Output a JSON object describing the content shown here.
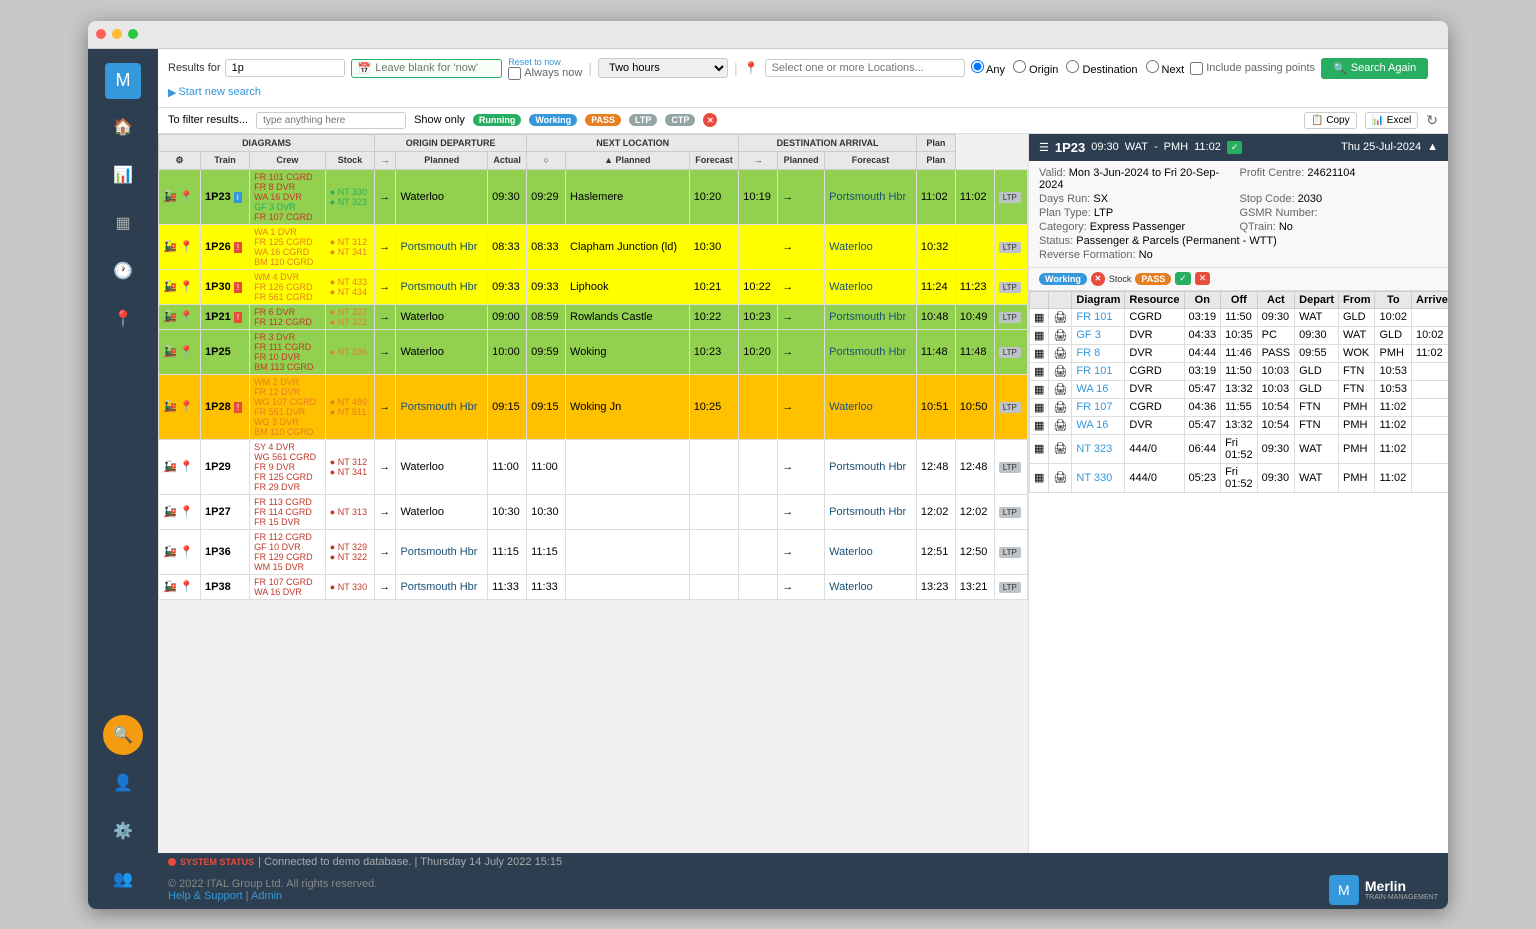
{
  "window": {
    "title": "Merlin Train Management"
  },
  "topbar": {
    "results_label": "Results for",
    "search_value": "1p",
    "datetime_placeholder": "Leave blank for 'now'",
    "always_now_label": "Always now",
    "reset_to_now": "Reset to now",
    "duration_value": "Two hours",
    "location_placeholder": "Select one or more Locations...",
    "radio_options": [
      "Any",
      "Origin",
      "Destination",
      "Next"
    ],
    "include_passing": "Include passing points",
    "search_again": "Search Again",
    "start_new_search": "Start new search"
  },
  "filterbar": {
    "filter_label": "To filter results...",
    "filter_placeholder": "type anything here",
    "show_only": "Show only",
    "badges": [
      "Running",
      "Working",
      "PASS",
      "LTP",
      "CTP"
    ],
    "buttons": [
      "Copy",
      "Excel"
    ]
  },
  "table": {
    "sections": {
      "diagrams": "DIAGRAMS",
      "origin_departure": "ORIGIN DEPARTURE",
      "next_location": "NEXT LOCATION",
      "destination_arrival": "DESTINATION ARRIVAL"
    },
    "columns": {
      "train": "Train",
      "crew": "Crew",
      "stock": "Stock",
      "origin_planned": "Planned",
      "origin_actual": "Actual",
      "next_planned": "Planned",
      "next_forecast": "Forecast",
      "dest_planned": "Planned",
      "dest_forecast": "Forecast",
      "plan": "Plan"
    },
    "rows": [
      {
        "id": "1P23",
        "color": "green",
        "origin": "Waterloo",
        "origin_planned": "09:30",
        "origin_actual": "09:29",
        "next_stop": "Haslemere",
        "next_planned": "10:20",
        "next_forecast": "10:19",
        "destination": "Portsmouth Hbr",
        "dest_planned": "11:02",
        "dest_forecast": "11:02",
        "plan": "LTP",
        "crew": [
          "FR 101 CGRD",
          "FR 8 DVR",
          "WA 16 DVR",
          "GF 3 DVR",
          "FR 107 CGRD"
        ],
        "crew_colors": [
          "red",
          "red",
          "red",
          "green",
          "red"
        ],
        "stock": [
          "NT 330",
          "NT 323"
        ],
        "stock_colors": [
          "green",
          "green"
        ]
      },
      {
        "id": "1P26",
        "color": "yellow",
        "origin": "Portsmouth Hbr",
        "origin_planned": "08:33",
        "origin_actual": "08:33",
        "next_stop": "Clapham Junction (ld)",
        "next_planned": "10:30",
        "next_forecast": "",
        "destination": "Waterloo",
        "dest_planned": "10:32",
        "dest_forecast": "",
        "plan": "LTP",
        "crew": [
          "WA 1 DVR",
          "FR 125 CGRD",
          "WA 16 CGRD",
          "BM 110 CGRD"
        ],
        "crew_colors": [
          "orange",
          "orange",
          "orange",
          "orange"
        ],
        "stock": [
          "NT 312",
          "NT 341"
        ],
        "stock_colors": [
          "orange",
          "orange"
        ]
      },
      {
        "id": "1P30",
        "color": "yellow",
        "origin": "Portsmouth Hbr",
        "origin_planned": "09:33",
        "origin_actual": "09:33",
        "next_stop": "Liphook",
        "next_planned": "10:21",
        "next_forecast": "10:22",
        "destination": "Waterloo",
        "dest_planned": "11:24",
        "dest_forecast": "11:23",
        "plan": "LTP",
        "crew": [
          "WM 4 DVR",
          "FR 126 CGRD",
          "FR 561 CGRD"
        ],
        "crew_colors": [
          "orange",
          "orange",
          "orange"
        ],
        "stock": [
          "NT 433",
          "NT 434"
        ],
        "stock_colors": [
          "orange",
          "orange"
        ]
      },
      {
        "id": "1P21",
        "color": "green",
        "origin": "Waterloo",
        "origin_planned": "09:00",
        "origin_actual": "08:59",
        "next_stop": "Rowlands Castle",
        "next_planned": "10:22",
        "next_forecast": "10:23",
        "destination": "Portsmouth Hbr",
        "dest_planned": "10:48",
        "dest_forecast": "10:49",
        "plan": "LTP",
        "crew": [
          "FR 6 DVR",
          "FR 112 CGRD"
        ],
        "crew_colors": [
          "red",
          "red"
        ],
        "stock": [
          "NT 327",
          "NT 322"
        ],
        "stock_colors": [
          "orange",
          "orange"
        ]
      },
      {
        "id": "1P25",
        "color": "green",
        "origin": "Waterloo",
        "origin_planned": "10:00",
        "origin_actual": "09:59",
        "next_stop": "Woking",
        "next_planned": "10:23",
        "next_forecast": "10:20",
        "destination": "Portsmouth Hbr",
        "dest_planned": "11:48",
        "dest_forecast": "11:48",
        "plan": "LTP",
        "crew": [
          "FR 3 DVR",
          "FR 111 CGRD",
          "FR 10 DVR",
          "BM 113 CGRD"
        ],
        "crew_colors": [
          "red",
          "red",
          "red",
          "red"
        ],
        "stock": [
          "NT 336"
        ],
        "stock_colors": [
          "orange"
        ]
      },
      {
        "id": "1P28",
        "color": "orange",
        "origin": "Portsmouth Hbr",
        "origin_planned": "09:15",
        "origin_actual": "09:15",
        "next_stop": "Woking Jn",
        "next_planned": "10:25",
        "next_forecast": "",
        "destination": "Waterloo",
        "dest_planned": "10:51",
        "dest_forecast": "10:50",
        "plan": "LTP",
        "crew": [
          "WM 2 DVR",
          "FR 12 DVR",
          "WG 107 CGRD",
          "FR 551 DVR",
          "WG 3 DVR",
          "BM 110 CGRD"
        ],
        "crew_colors": [
          "orange",
          "orange",
          "orange",
          "orange",
          "orange",
          "orange"
        ],
        "stock": [
          "NT 489",
          "NT 511"
        ],
        "stock_colors": [
          "orange",
          "orange"
        ]
      },
      {
        "id": "1P29",
        "color": "white",
        "origin": "Waterloo",
        "origin_planned": "11:00",
        "origin_actual": "11:00",
        "next_stop": "",
        "next_planned": "",
        "next_forecast": "",
        "destination": "Portsmouth Hbr",
        "dest_planned": "12:48",
        "dest_forecast": "12:48",
        "plan": "LTP",
        "crew": [
          "SY 4 DVR",
          "WG 561 CGRD",
          "FR 9 DVR",
          "FR 125 CGRD",
          "FR 29 DVR"
        ],
        "crew_colors": [
          "red",
          "red",
          "red",
          "red",
          "red"
        ],
        "stock": [
          "NT 312",
          "NT 341"
        ],
        "stock_colors": [
          "red",
          "red"
        ]
      },
      {
        "id": "1P27",
        "color": "white",
        "origin": "Waterloo",
        "origin_planned": "10:30",
        "origin_actual": "10:30",
        "next_stop": "",
        "next_planned": "",
        "next_forecast": "",
        "destination": "Portsmouth Hbr",
        "dest_planned": "12:02",
        "dest_forecast": "12:02",
        "plan": "LTP",
        "crew": [
          "FR 113 CGRD",
          "FR 114 CGRD",
          "FR 15 DVR"
        ],
        "crew_colors": [
          "red",
          "red",
          "red"
        ],
        "stock": [
          "NT 313"
        ],
        "stock_colors": [
          "red"
        ]
      },
      {
        "id": "1P36",
        "color": "white",
        "origin": "Portsmouth Hbr",
        "origin_planned": "11:15",
        "origin_actual": "11:15",
        "next_stop": "",
        "next_planned": "",
        "next_forecast": "",
        "destination": "Waterloo",
        "dest_planned": "12:51",
        "dest_forecast": "12:50",
        "plan": "LTP",
        "crew": [
          "FR 112 CGRD",
          "GF 10 DVR",
          "FR 129 CGRD",
          "WM 15 DVR"
        ],
        "crew_colors": [
          "red",
          "red",
          "red",
          "red"
        ],
        "stock": [
          "NT 329",
          "NT 322"
        ],
        "stock_colors": [
          "red",
          "red"
        ]
      },
      {
        "id": "1P38",
        "color": "white",
        "origin": "Portsmouth Hbr",
        "origin_planned": "11:33",
        "origin_actual": "11:33",
        "next_stop": "",
        "next_planned": "",
        "next_forecast": "",
        "destination": "Waterloo",
        "dest_planned": "13:23",
        "dest_forecast": "13:21",
        "plan": "LTP",
        "crew": [
          "FR 107 CGRD",
          "WA 16 DVR"
        ],
        "crew_colors": [
          "red",
          "red"
        ],
        "stock": [
          "NT 330"
        ],
        "stock_colors": [
          "red"
        ]
      }
    ]
  },
  "detail_panel": {
    "train_id": "1P23",
    "time_from": "09:30",
    "from_code": "WAT",
    "time_to": "11:02",
    "to_code": "PMH",
    "date": "Thu 25-Jul-2024",
    "valid": "Mon 3-Jun-2024 to Fri 20-Sep-2024",
    "days_run": "SX",
    "plan_type": "LTP",
    "category": "Express Passenger",
    "status": "Passenger & Parcels (Permanent - WTT)",
    "profit_centre": "24621104",
    "stop_code": "2030",
    "gsmr_number": "",
    "qtrain": "No",
    "reverse_formation": "No",
    "badges": [
      "Working",
      "Stock",
      "PASS"
    ],
    "detail_columns": [
      "",
      "",
      "Diagram",
      "Resource",
      "On",
      "Off",
      "Act",
      "Depart",
      "From",
      "To",
      "Arrive"
    ],
    "detail_rows": [
      {
        "diagram": "FR 101",
        "resource": "CGRD",
        "on": "03:19",
        "off": "11:50",
        "act": "09:30",
        "depart": "WAT",
        "from": "GLD",
        "to": "10:02",
        "arrive": ""
      },
      {
        "diagram": "GF 3",
        "resource": "DVR",
        "on": "04:33",
        "off": "10:35",
        "act": "PC",
        "depart": "09:30",
        "from": "WAT",
        "to": "GLD",
        "arrive": "10:02"
      },
      {
        "diagram": "FR 8",
        "resource": "DVR",
        "on": "04:44",
        "off": "11:46",
        "act": "PASS",
        "depart": "09:55",
        "from": "WOK",
        "to": "PMH",
        "arrive": "11:02"
      },
      {
        "diagram": "FR 101",
        "resource": "CGRD",
        "on": "03:19",
        "off": "11:50",
        "act": "10:03",
        "depart": "GLD",
        "from": "FTN",
        "to": "10:53",
        "arrive": ""
      },
      {
        "diagram": "WA 16",
        "resource": "DVR",
        "on": "05:47",
        "off": "13:32",
        "act": "10:03",
        "depart": "GLD",
        "from": "FTN",
        "to": "10:53",
        "arrive": ""
      },
      {
        "diagram": "FR 107",
        "resource": "CGRD",
        "on": "04:36",
        "off": "11:55",
        "act": "10:54",
        "depart": "FTN",
        "from": "PMH",
        "to": "11:02",
        "arrive": ""
      },
      {
        "diagram": "WA 16",
        "resource": "DVR",
        "on": "05:47",
        "off": "13:32",
        "act": "10:54",
        "depart": "FTN",
        "from": "PMH",
        "to": "11:02",
        "arrive": ""
      },
      {
        "diagram": "NT 323",
        "resource": "444/0",
        "on": "06:44",
        "off": "Fri 01:52",
        "act": "09:30",
        "depart": "WAT",
        "from": "PMH",
        "to": "11:02",
        "arrive": ""
      },
      {
        "diagram": "NT 330",
        "resource": "444/0",
        "on": "05:23",
        "off": "Fri 01:52",
        "act": "09:30",
        "depart": "WAT",
        "from": "PMH",
        "to": "11:02",
        "arrive": ""
      }
    ]
  },
  "statusbar": {
    "status_label": "SYSTEM STATUS",
    "status_text": "| Connected to demo database. | Thursday 14 July 2022 15:15"
  },
  "footer": {
    "copyright": "© 2022 ITAL Group Ltd. All rights reserved.",
    "links": [
      "Help & Support",
      "Admin"
    ],
    "logo_text": "Merlin",
    "logo_sub": "TRAIN MANAGEMENT"
  },
  "sidebar": {
    "items": [
      {
        "icon": "🏠",
        "name": "home"
      },
      {
        "icon": "📊",
        "name": "dashboard"
      },
      {
        "icon": "📋",
        "name": "board"
      },
      {
        "icon": "🕐",
        "name": "history"
      },
      {
        "icon": "📍",
        "name": "location"
      },
      {
        "icon": "🔍",
        "name": "search"
      },
      {
        "icon": "👤",
        "name": "user"
      },
      {
        "icon": "⚙️",
        "name": "settings"
      },
      {
        "icon": "👥",
        "name": "admin"
      }
    ]
  }
}
